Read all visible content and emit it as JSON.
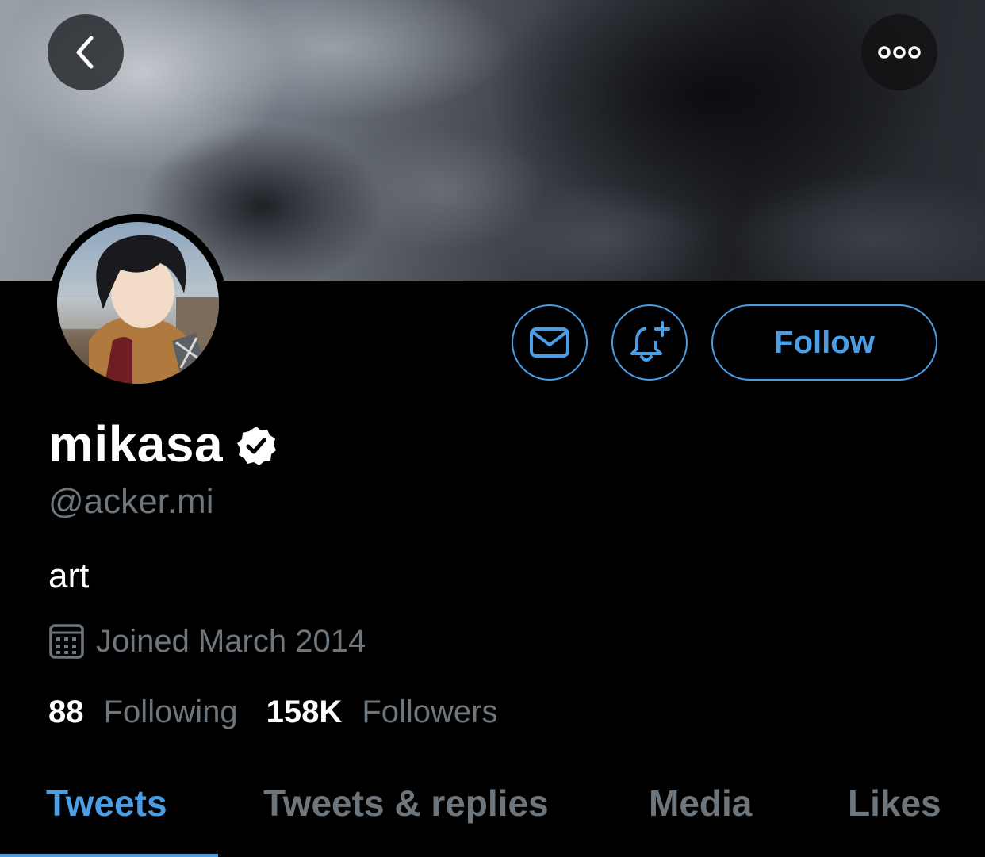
{
  "profile": {
    "name": "mikasa",
    "handle": "@acker.mi",
    "bio": "art",
    "joined": "Joined March 2014",
    "following_count": "88",
    "following_label": "Following",
    "followers_count": "158K",
    "followers_label": "Followers",
    "verified": true
  },
  "actions": {
    "follow_label": "Follow"
  },
  "tabs": [
    {
      "label": "Tweets",
      "active": true
    },
    {
      "label": "Tweets & replies",
      "active": false
    },
    {
      "label": "Media",
      "active": false
    },
    {
      "label": "Likes",
      "active": false
    }
  ],
  "icons": {
    "back": "chevron-left-icon",
    "more": "more-icon",
    "message": "mail-icon",
    "notify": "bell-plus-icon",
    "verified": "verified-badge-icon",
    "calendar": "calendar-icon"
  },
  "colors": {
    "accent": "#4a9ee6",
    "muted_text": "#6e767d",
    "background": "#000000"
  }
}
